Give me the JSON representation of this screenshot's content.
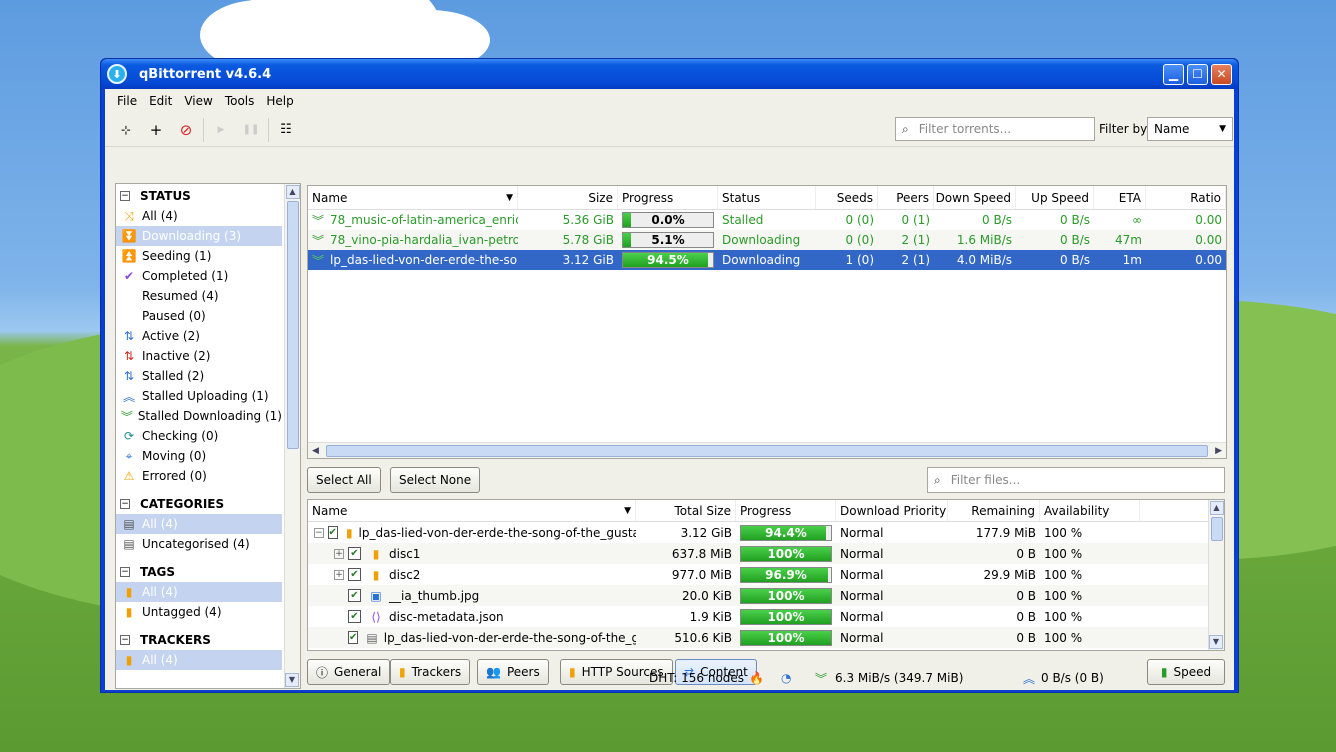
{
  "window": {
    "title": "qBittorrent v4.6.4",
    "minimize": "▁",
    "maximize": "☐",
    "close": "✕"
  },
  "menu": [
    "File",
    "Edit",
    "View",
    "Tools",
    "Help"
  ],
  "toolbar": {
    "filter_placeholder": "Filter torrents...",
    "filter_by_label": "Filter by:",
    "filter_by_value": "Name"
  },
  "sidebar": {
    "status_title": "STATUS",
    "status_items": [
      {
        "label": "All (4)",
        "icon": "shuffle-icon"
      },
      {
        "label": "Downloading (3)",
        "icon": "double-chevron-down-icon"
      },
      {
        "label": "Seeding (1)",
        "icon": "double-chevron-up-icon"
      },
      {
        "label": "Completed (1)",
        "icon": "check-icon"
      },
      {
        "label": "Resumed (4)",
        "icon": "play-icon"
      },
      {
        "label": "Paused (0)",
        "icon": "pause-icon"
      },
      {
        "label": "Active (2)",
        "icon": "up-down-arrows-icon"
      },
      {
        "label": "Inactive (2)",
        "icon": "up-down-arrows-icon"
      },
      {
        "label": "Stalled (2)",
        "icon": "up-down-arrows-icon"
      },
      {
        "label": "Stalled Uploading (1)",
        "icon": "double-chevron-up-icon"
      },
      {
        "label": "Stalled Downloading (1)",
        "icon": "double-chevron-down-icon"
      },
      {
        "label": "Checking (0)",
        "icon": "refresh-icon"
      },
      {
        "label": "Moving (0)",
        "icon": "crosshair-icon"
      },
      {
        "label": "Errored (0)",
        "icon": "warning-icon"
      }
    ],
    "categories_title": "CATEGORIES",
    "categories": [
      "All (4)",
      "Uncategorised (4)"
    ],
    "tags_title": "TAGS",
    "tags": [
      "All (4)",
      "Untagged (4)"
    ],
    "trackers_title": "TRACKERS",
    "trackers": [
      "All (4)"
    ]
  },
  "torrents": {
    "headers": [
      "Name",
      "Size",
      "Progress",
      "Status",
      "Seeds",
      "Peers",
      "Down Speed",
      "Up Speed",
      "ETA",
      "Ratio"
    ],
    "rows": [
      {
        "name": "78_music-of-latin-america_enric-...",
        "size": "5.36 GiB",
        "progress": 0.0,
        "progress_label": "0.0%",
        "status": "Stalled",
        "seeds": "0 (0)",
        "peers": "0 (1)",
        "down": "0 B/s",
        "up": "0 B/s",
        "eta": "∞",
        "ratio": "0.00"
      },
      {
        "name": "78_vino-pia-hardalia_ivan-petrof...",
        "size": "5.78 GiB",
        "progress": 5.1,
        "progress_label": "5.1%",
        "status": "Downloading",
        "seeds": "0 (0)",
        "peers": "2 (1)",
        "down": "1.6 MiB/s",
        "up": "0 B/s",
        "eta": "47m",
        "ratio": "0.00"
      },
      {
        "name": "lp_das-lied-von-der-erde-the-son...",
        "size": "3.12 GiB",
        "progress": 94.5,
        "progress_label": "94.5%",
        "status": "Downloading",
        "seeds": "1 (0)",
        "peers": "2 (1)",
        "down": "4.0 MiB/s",
        "up": "0 B/s",
        "eta": "1m",
        "ratio": "0.00"
      }
    ]
  },
  "content": {
    "select_all": "Select All",
    "select_none": "Select None",
    "filter_placeholder": "Filter files...",
    "headers": [
      "Name",
      "Total Size",
      "Progress",
      "Download Priority",
      "Remaining",
      "Availability"
    ],
    "rows": [
      {
        "name": "lp_das-lied-von-der-erde-the-song-of-the_gusta...",
        "size": "3.12 GiB",
        "progress": 94.4,
        "progress_label": "94.4%",
        "priority": "Normal",
        "remaining": "177.9 MiB",
        "availability": "100 %",
        "level": 0,
        "type": "folder"
      },
      {
        "name": "disc1",
        "size": "637.8 MiB",
        "progress": 100,
        "progress_label": "100%",
        "priority": "Normal",
        "remaining": "0 B",
        "availability": "100 %",
        "level": 1,
        "type": "folder"
      },
      {
        "name": "disc2",
        "size": "977.0 MiB",
        "progress": 96.9,
        "progress_label": "96.9%",
        "priority": "Normal",
        "remaining": "29.9 MiB",
        "availability": "100 %",
        "level": 1,
        "type": "folder"
      },
      {
        "name": "__ia_thumb.jpg",
        "size": "20.0 KiB",
        "progress": 100,
        "progress_label": "100%",
        "priority": "Normal",
        "remaining": "0 B",
        "availability": "100 %",
        "level": 1,
        "type": "image"
      },
      {
        "name": "disc-metadata.json",
        "size": "1.9 KiB",
        "progress": 100,
        "progress_label": "100%",
        "priority": "Normal",
        "remaining": "0 B",
        "availability": "100 %",
        "level": 1,
        "type": "json"
      },
      {
        "name": "lp_das-lied-von-der-erde-the-song-of-the_g...",
        "size": "510.6 KiB",
        "progress": 100,
        "progress_label": "100%",
        "priority": "Normal",
        "remaining": "0 B",
        "availability": "100 %",
        "level": 1,
        "type": "file"
      }
    ]
  },
  "tabs": [
    "General",
    "Trackers",
    "Peers",
    "HTTP Sources",
    "Content"
  ],
  "speed_button": "Speed",
  "statusbar": {
    "dht": "DHT: 156 nodes",
    "download": "6.3 MiB/s (349.7 MiB)",
    "upload": "0 B/s (0 B)"
  }
}
